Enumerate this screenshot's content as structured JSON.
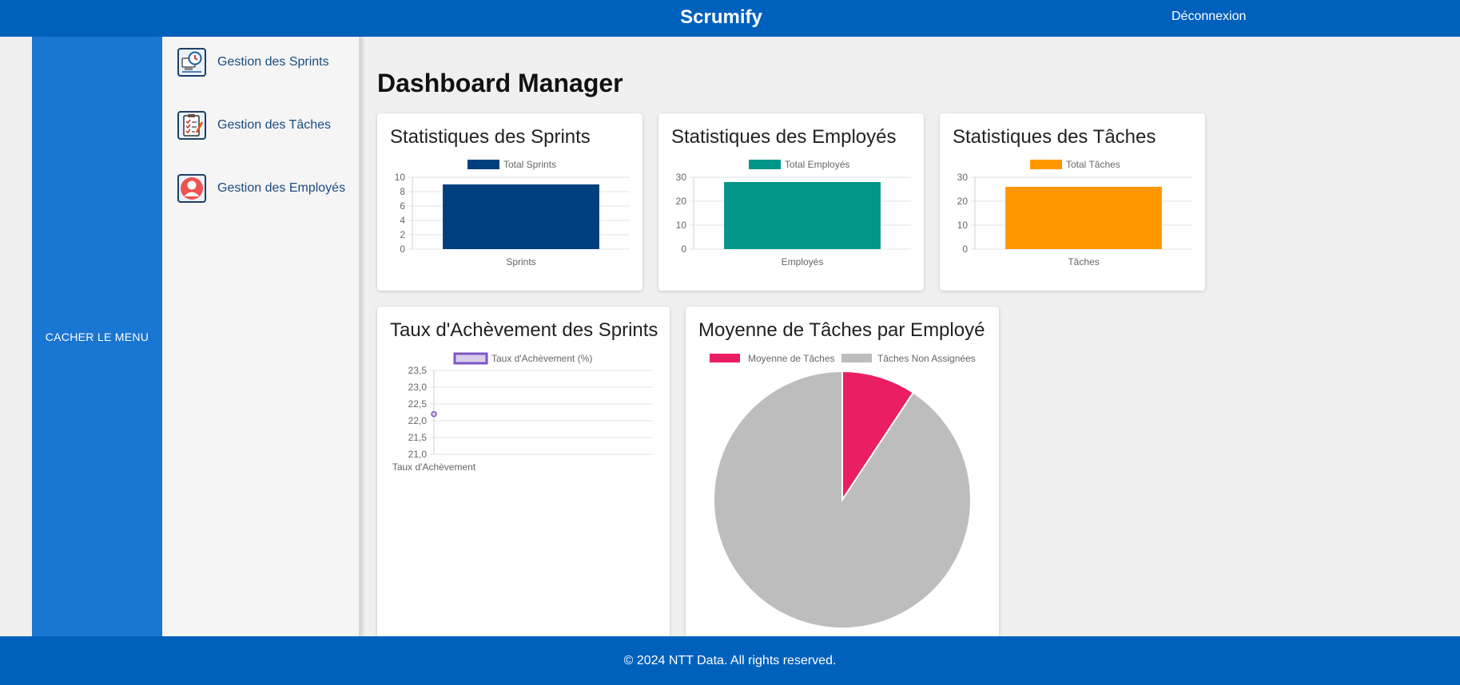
{
  "header": {
    "brand": "Scrumify",
    "logout_label": "Déconnexion"
  },
  "sidebar": {
    "toggle_label": "CACHER LE MENU"
  },
  "menu": {
    "items": [
      {
        "label": "Gestion des Sprints",
        "icon": "sprint-clock-icon"
      },
      {
        "label": "Gestion des Tâches",
        "icon": "clipboard-checklist-icon"
      },
      {
        "label": "Gestion des Employés",
        "icon": "employee-avatar-icon"
      }
    ]
  },
  "main": {
    "title": "Dashboard Manager"
  },
  "cards": {
    "sprints": {
      "title": "Statistiques des Sprints"
    },
    "employes": {
      "title": "Statistiques des Employés"
    },
    "taches": {
      "title": "Statistiques des Tâches"
    },
    "achevement": {
      "title": "Taux d'Achèvement des Sprints"
    },
    "moyenne": {
      "title": "Moyenne de Tâches par Employé"
    }
  },
  "chart_data": [
    {
      "id": "sprints",
      "type": "bar",
      "categories": [
        "Sprints"
      ],
      "series": [
        {
          "name": "Total Sprints",
          "values": [
            9
          ],
          "color": "#003f7d"
        }
      ],
      "ylim": [
        0,
        10
      ],
      "yticks": [
        "0",
        "2",
        "4",
        "6",
        "8",
        "10"
      ],
      "grid": true,
      "legend": "top"
    },
    {
      "id": "employes",
      "type": "bar",
      "categories": [
        "Employés"
      ],
      "series": [
        {
          "name": "Total Employés",
          "values": [
            28
          ],
          "color": "#009688"
        }
      ],
      "ylim": [
        0,
        30
      ],
      "yticks": [
        "0",
        "10",
        "20",
        "30"
      ],
      "grid": true,
      "legend": "top"
    },
    {
      "id": "taches",
      "type": "bar",
      "categories": [
        "Tâches"
      ],
      "series": [
        {
          "name": "Total Tâches",
          "values": [
            26
          ],
          "color": "#ff9800"
        }
      ],
      "ylim": [
        0,
        30
      ],
      "yticks": [
        "0",
        "10",
        "20",
        "30"
      ],
      "grid": true,
      "legend": "top"
    },
    {
      "id": "achevement",
      "type": "line",
      "categories": [
        "Taux d'Achèvement"
      ],
      "series": [
        {
          "name": "Taux d'Achèvement (%)",
          "values": [
            22.2
          ],
          "color": "#7e57c2",
          "fill": "#d8cdea"
        }
      ],
      "ylim": [
        21.0,
        23.5
      ],
      "yticks": [
        "21,0",
        "21,5",
        "22,0",
        "22,5",
        "23,0",
        "23,5"
      ],
      "grid": true,
      "legend": "top"
    },
    {
      "id": "moyenne",
      "type": "pie",
      "labels": [
        "Moyenne de Tâches",
        "Tâches Non Assignées"
      ],
      "values": [
        9.3,
        90.7
      ],
      "colors": [
        "#e91e63",
        "#bdbdbd"
      ],
      "legend": "top"
    }
  ],
  "footer": {
    "text": "© 2024 NTT Data. All rights reserved."
  }
}
